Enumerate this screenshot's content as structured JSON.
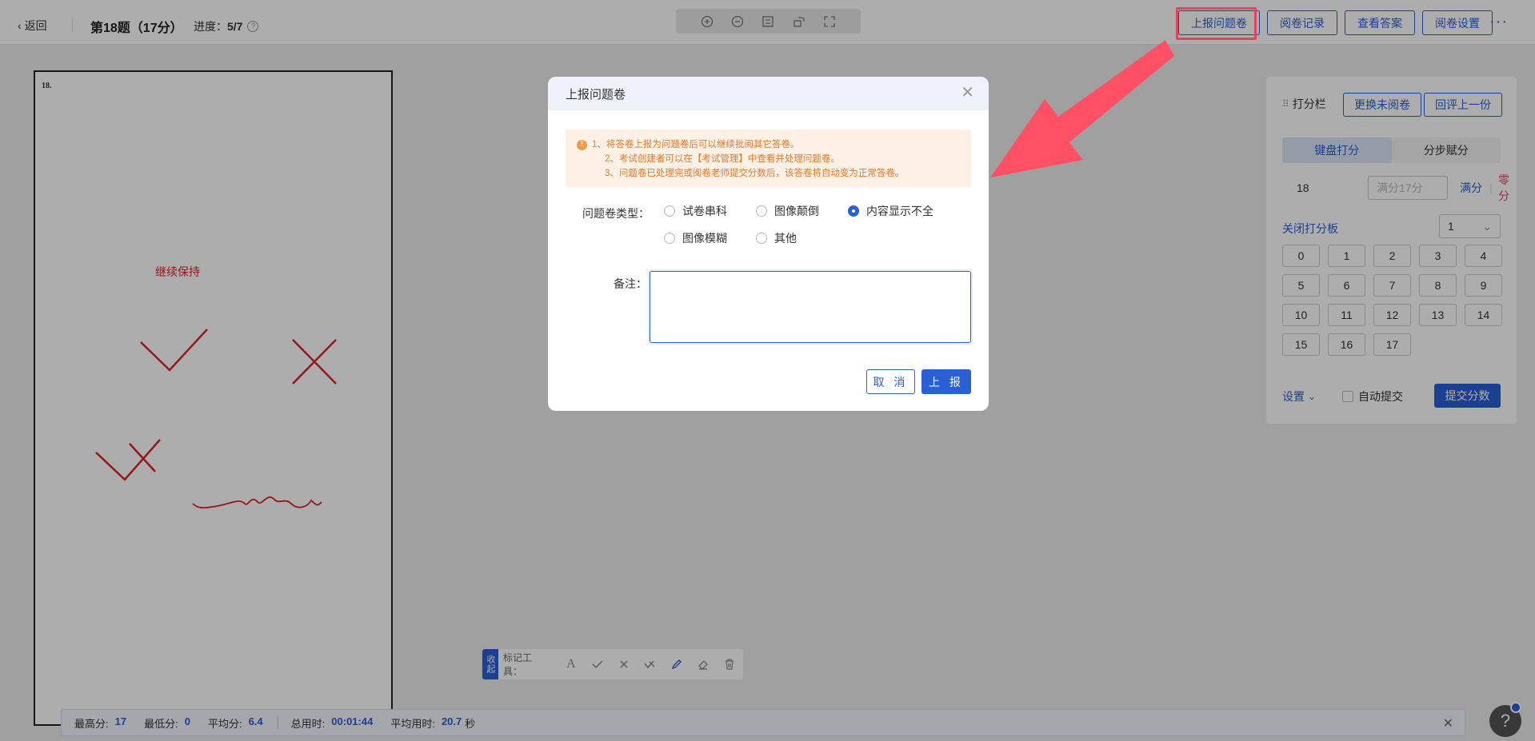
{
  "header": {
    "back_label": "返回",
    "question_title": "第18题（17分）",
    "progress_label": "进度：",
    "progress_value": "5/7",
    "buttons": {
      "report": "上报问题卷",
      "records": "阅卷记录",
      "answers": "查看答案",
      "settings": "阅卷设置"
    },
    "more_label": "···"
  },
  "sheet": {
    "question_number": "18.",
    "comment_text": "继续保持"
  },
  "scoring_panel": {
    "title": "打分栏",
    "swap_button": "更换未阅卷",
    "prev_button": "回评上一份",
    "tabs": [
      "键盘打分",
      "分步赋分"
    ],
    "question_no": "18",
    "score_placeholder": "满分17分",
    "full_label": "满分",
    "zero_label": "零分",
    "close_board": "关闭打分板",
    "step_value": "1",
    "keys": [
      "0",
      "1",
      "2",
      "3",
      "4",
      "5",
      "6",
      "7",
      "8",
      "9",
      "10",
      "11",
      "12",
      "13",
      "14",
      "15",
      "16",
      "17"
    ],
    "settings_label": "设置",
    "auto_submit_label": "自动提交",
    "submit_label": "提交分数"
  },
  "annotation_toolbar": {
    "collapse_label": "收起",
    "label": "标记工具："
  },
  "stats": {
    "max_label": "最高分:",
    "max_value": "17",
    "min_label": "最低分:",
    "min_value": "0",
    "avg_label": "平均分:",
    "avg_value": "6.4",
    "total_time_label": "总用时:",
    "total_time_value": "00:01:44",
    "avg_time_label": "平均用时:",
    "avg_time_value": "20.7",
    "avg_time_unit": "秒"
  },
  "help_label": "?",
  "modal": {
    "title": "上报问题卷",
    "notice": [
      "1、将答卷上报为问题卷后可以继续批阅其它答卷。",
      "2、考试创建者可以在【考试管理】中查看并处理问题卷。",
      "3、问题卷已处理完或阅卷老师提交分数后，该答卷将自动变为正常答卷。"
    ],
    "type_label": "问题卷类型：",
    "options": [
      "试卷串科",
      "图像颠倒",
      "内容显示不全",
      "图像模糊",
      "其他"
    ],
    "selected_option": "内容显示不全",
    "remark_label": "备注：",
    "remark_value": "",
    "cancel_label": "取 消",
    "confirm_label": "上 报"
  },
  "colors": {
    "primary": "#2a5fd6",
    "highlight": "#e5435e",
    "notice_bg": "#fdf0e5",
    "notice_text": "#e8782f",
    "mark_red": "#d22"
  }
}
